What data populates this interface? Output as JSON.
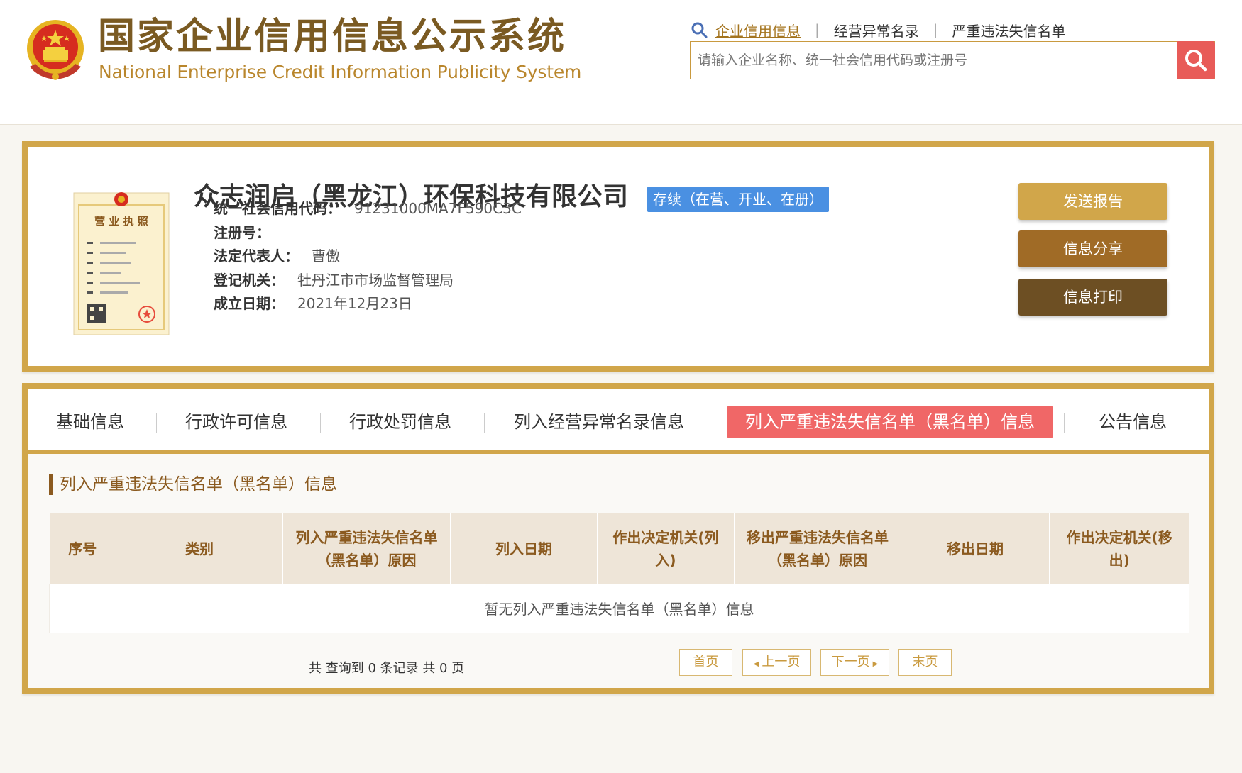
{
  "header": {
    "title_cn": "国家企业信用信息公示系统",
    "title_en": "National Enterprise Credit Information Publicity System",
    "search_icon": "magnifier-icon",
    "nav": [
      {
        "label": "企业信用信息",
        "active": true
      },
      {
        "label": "经营异常名录",
        "active": false
      },
      {
        "label": "严重违法失信名单",
        "active": false
      }
    ],
    "separator": "|",
    "search_placeholder": "请输入企业名称、统一社会信用代码或注册号",
    "search_value": ""
  },
  "company": {
    "name": "众志润启（黑龙江）环保科技有限公司",
    "status": "存续（在营、开业、在册）",
    "fields": [
      {
        "label": "统一社会信用代码：",
        "value": "91231000MA7F590C3C"
      },
      {
        "label": "注册号：",
        "value": ""
      },
      {
        "label": "法定代表人：",
        "value": "曹傲"
      },
      {
        "label": "登记机关：",
        "value": "牡丹江市市场监督管理局"
      },
      {
        "label": "成立日期：",
        "value": "2021年12月23日"
      }
    ],
    "license_title": "营 业 执 照"
  },
  "actions": {
    "send_report": "发送报告",
    "share": "信息分享",
    "print": "信息打印"
  },
  "tabs": [
    {
      "label": "基础信息",
      "active": false
    },
    {
      "label": "行政许可信息",
      "active": false
    },
    {
      "label": "行政处罚信息",
      "active": false
    },
    {
      "label": "列入经营异常名录信息",
      "active": false
    },
    {
      "label": "列入严重违法失信名单（黑名单）信息",
      "active": true
    },
    {
      "label": "公告信息",
      "active": false
    }
  ],
  "section": {
    "title": "列入严重违法失信名单（黑名单）信息",
    "columns": [
      "序号",
      "类别",
      "列入严重违法失信名单（黑名单）原因",
      "列入日期",
      "作出决定机关(列入)",
      "移出严重违法失信名单（黑名单）原因",
      "移出日期",
      "作出决定机关(移出)"
    ],
    "empty_message": "暂无列入严重违法失信名单（黑名单）信息"
  },
  "pagination": {
    "summary": "共 查询到 0 条记录 共 0 页",
    "first": "首页",
    "prev": "上一页",
    "next": "下一页",
    "last": "末页"
  },
  "colors": {
    "gold_border": "#d1a64a",
    "brown_title": "#7a5a22",
    "status_blue": "#4a90e2",
    "active_tab_red": "#f06767",
    "search_red": "#e85b58"
  }
}
